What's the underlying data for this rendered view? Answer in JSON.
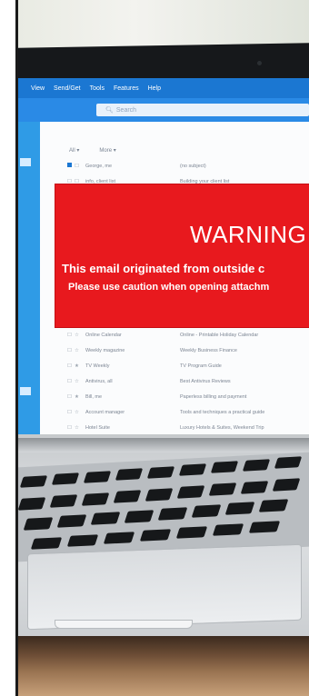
{
  "menu": [
    "View",
    "Send/Get",
    "Tools",
    "Features",
    "Help"
  ],
  "search": {
    "placeholder": "Search"
  },
  "list_header": {
    "all": "All ▾",
    "more": "More ▾"
  },
  "emails": [
    {
      "from": "George, me",
      "subject": "(no subject)",
      "unread": true
    },
    {
      "from": "info, client list",
      "subject": "Building your client list",
      "unread": false
    },
    {
      "from": "Online Calendar",
      "subject": "Online - Printable Holiday Calendar",
      "unread": false
    },
    {
      "from": "Weekly magazine",
      "subject": "Weekly Business Finance",
      "unread": false
    },
    {
      "from": "TV Weekly",
      "subject": "TV Program Guide",
      "unread": false,
      "flagged": true
    },
    {
      "from": "Antivirus, all",
      "subject": "Best Antivirus Reviews",
      "unread": false
    },
    {
      "from": "Bill, me",
      "subject": "Paperless billing and payment",
      "unread": false,
      "flagged": true
    },
    {
      "from": "Account manager",
      "subject": "Tools and techniques a practical guide",
      "unread": false
    },
    {
      "from": "Hotel Suite",
      "subject": "Luxury Hotels & Suites, Weekend Trip",
      "unread": false
    }
  ],
  "warning": {
    "title": "WARNING",
    "line1": "This email originated from outside c",
    "line2": "Please use caution when opening attachm"
  },
  "colors": {
    "warning_bg": "#e8191e",
    "app_accent": "#1b77d2"
  }
}
